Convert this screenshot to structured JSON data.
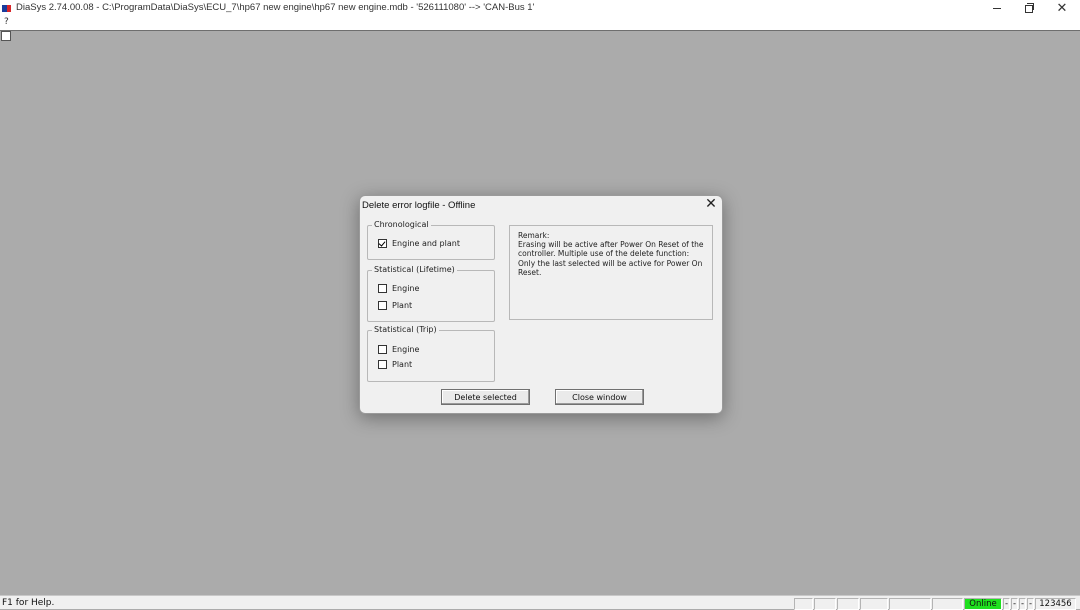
{
  "window": {
    "title": "DiaSys 2.74.00.08 - C:\\ProgramData\\DiaSys\\ECU_7\\hp67 new engine\\hp67 new engine.mdb - '526111080' --> 'CAN-Bus 1'",
    "minimize_icon": "minimize-icon",
    "maximize_icon": "restore-icon",
    "close_icon": "close-icon"
  },
  "menu": {
    "help": "?"
  },
  "dialog": {
    "title": "Delete error logfile - Offline",
    "close_glyph": "✕",
    "groups": {
      "chronological": {
        "label": "Chronological",
        "items": [
          {
            "label": "Engine and plant",
            "checked": true
          }
        ]
      },
      "lifetime": {
        "label": "Statistical (Lifetime)",
        "items": [
          {
            "label": "Engine",
            "checked": false
          },
          {
            "label": "Plant",
            "checked": false
          }
        ]
      },
      "trip": {
        "label": "Statistical (Trip)",
        "items": [
          {
            "label": "Engine",
            "checked": false
          },
          {
            "label": "Plant",
            "checked": false
          }
        ]
      }
    },
    "remark": {
      "heading": "Remark:",
      "line1": "Erasing will be active after Power On Reset of the",
      "line2": "controller. Multiple use of the delete function:",
      "line3": "Only the last selected will be active for Power On",
      "line4": "Reset."
    },
    "buttons": {
      "delete": "Delete selected",
      "close": "Close window"
    }
  },
  "statusbar": {
    "help_text": "F1 for Help.",
    "online": "Online",
    "dash1": "-",
    "dash2": "-",
    "dash3": "-",
    "dash4": "-",
    "code": "123456",
    "online_color": "#1fe01f"
  }
}
